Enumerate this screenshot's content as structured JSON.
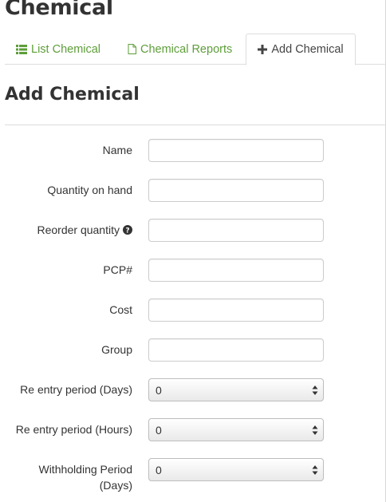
{
  "page": {
    "title": "Chemical"
  },
  "tabs": [
    {
      "label": "List Chemical",
      "icon": "list-icon"
    },
    {
      "label": "Chemical Reports",
      "icon": "file-icon"
    },
    {
      "label": "Add Chemical",
      "icon": "plus-icon",
      "active": true
    }
  ],
  "form": {
    "title": "Add Chemical",
    "fields": [
      {
        "label": "Name",
        "value": ""
      },
      {
        "label": "Quantity on hand",
        "value": ""
      },
      {
        "label": "Reorder quantity",
        "value": "",
        "help_icon": "question-circle-icon"
      },
      {
        "label": "PCP#",
        "value": ""
      },
      {
        "label": "Cost",
        "value": ""
      },
      {
        "label": "Group",
        "value": ""
      }
    ],
    "selects": [
      {
        "label": "Re entry period (Days)",
        "value": "0"
      },
      {
        "label": "Re entry period (Hours)",
        "value": "0"
      },
      {
        "label_line1": "Withholding Period",
        "label_line2": "(Days)",
        "value": "0"
      }
    ]
  },
  "colors": {
    "link": "#5e9e3a",
    "border": "#dddddd",
    "text": "#333333"
  }
}
